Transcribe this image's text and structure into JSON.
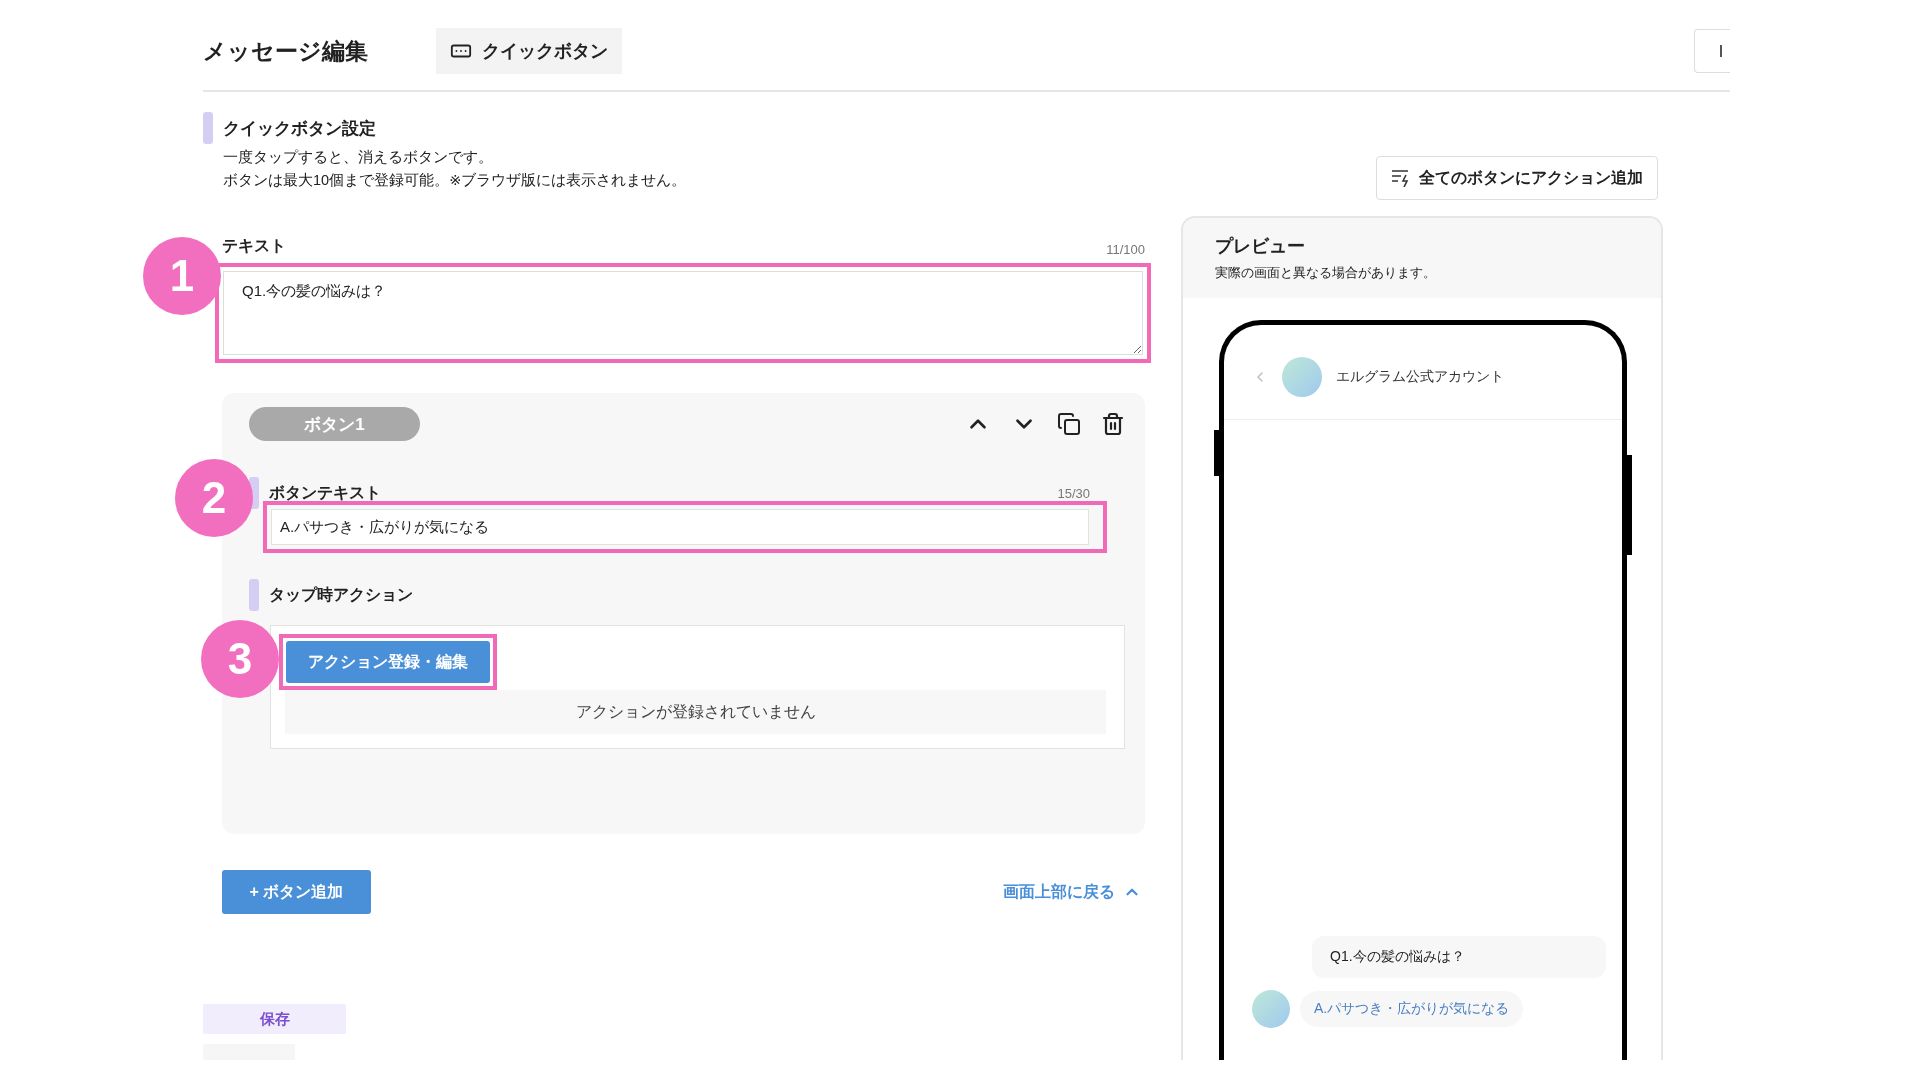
{
  "header": {
    "title": "メッセージ編集",
    "tab": {
      "label": "クイックボタン",
      "selected": true
    }
  },
  "section": {
    "title": "クイックボタン設定",
    "descriptions": [
      "一度タップすると、消えるボタンです。",
      "ボタンは最大10個まで登録可能。※ブラウザ版には表示されません。"
    ],
    "bulk_action_button": "全てのボタンにアクション追加"
  },
  "text_field": {
    "label": "テキスト",
    "counter": "11/100",
    "value": "Q1.今の髪の悩みは？",
    "highlighted": true,
    "callout": "1"
  },
  "buttons": [
    {
      "badge": "ボタン1",
      "text_label": "ボタンテキスト",
      "counter": "15/30",
      "value": "A.パサつき・広がりが気になる",
      "text_highlighted": true,
      "text_callout": "2",
      "action_label": "タップ時アクション",
      "action_button": "アクション登録・編集",
      "action_highlighted": true,
      "action_callout": "3",
      "empty_message": "アクションが登録されていません"
    }
  ],
  "add_button": "+ ボタン追加",
  "back_to_top": "画面上部に戻る",
  "save_button": "保存",
  "preview": {
    "title": "プレビュー",
    "note": "実際の画面と異なる場合があります。",
    "account_name": "エルグラム公式アカウント",
    "message": "Q1.今の髪の悩みは？",
    "quick_reply": "A.パサつき・広がりが気になる"
  }
}
